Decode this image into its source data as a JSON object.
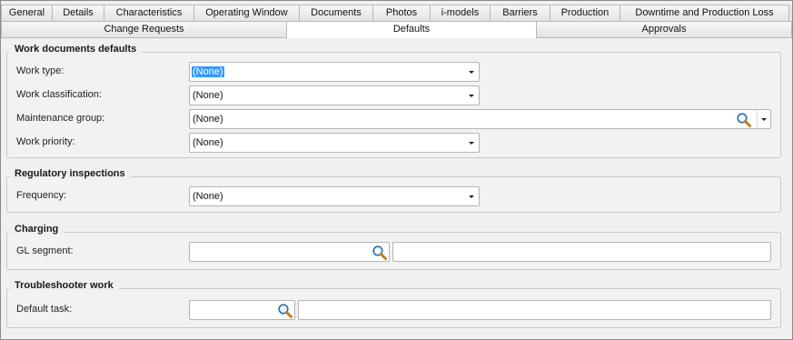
{
  "tabs_row1": [
    {
      "label": "General"
    },
    {
      "label": "Details"
    },
    {
      "label": "Characteristics"
    },
    {
      "label": "Operating Window"
    },
    {
      "label": "Documents"
    },
    {
      "label": "Photos"
    },
    {
      "label": "i-models"
    },
    {
      "label": "Barriers"
    },
    {
      "label": "Production"
    },
    {
      "label": "Downtime and Production Loss"
    }
  ],
  "tabs_row2": [
    {
      "label": "Change Requests"
    },
    {
      "label": "Defaults"
    },
    {
      "label": "Approvals"
    }
  ],
  "active_tab": "Defaults",
  "work_documents": {
    "title": "Work documents defaults",
    "work_type": {
      "label": "Work type:",
      "value": "(None)"
    },
    "work_classification": {
      "label": "Work classification:",
      "value": "(None)"
    },
    "maintenance_group": {
      "label": "Maintenance group:",
      "value": "(None)",
      "icon": "search-icon"
    },
    "work_priority": {
      "label": "Work priority:",
      "value": "(None)"
    }
  },
  "regulatory": {
    "title": "Regulatory inspections",
    "frequency": {
      "label": "Frequency:",
      "value": "(None)"
    }
  },
  "charging": {
    "title": "Charging",
    "gl_segment": {
      "label": "GL segment:",
      "value": "",
      "description": "",
      "icon": "search-icon"
    }
  },
  "troubleshooter": {
    "title": "Troubleshooter work",
    "default_task": {
      "label": "Default task:",
      "value": "",
      "description": "",
      "icon": "search-icon"
    }
  },
  "colors": {
    "selection": "#3399ff",
    "tab_border": "#b9b9b9",
    "panel": "#f0f0f0"
  }
}
